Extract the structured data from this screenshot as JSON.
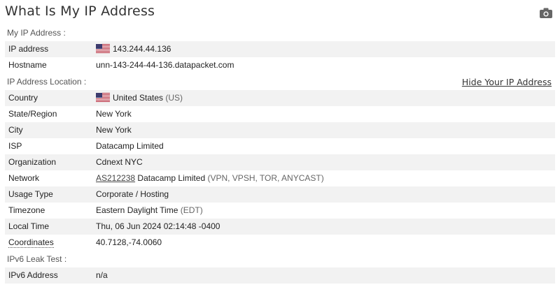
{
  "title": "What Is My IP Address",
  "icons": {
    "camera": "camera-icon",
    "flag": "us-flag-icon"
  },
  "sections": {
    "my_ip": {
      "heading": "My IP Address :",
      "ip_address": {
        "label": "IP address",
        "value": "143.244.44.136"
      },
      "hostname": {
        "label": "Hostname",
        "value": "unn-143-244-44-136.datapacket.com"
      }
    },
    "location": {
      "heading": "IP Address Location :",
      "hide_link": "Hide Your IP Address",
      "country": {
        "label": "Country",
        "value": "United States",
        "code": "(US)"
      },
      "state": {
        "label": "State/Region",
        "value": "New York"
      },
      "city": {
        "label": "City",
        "value": "New York"
      },
      "isp": {
        "label": "ISP",
        "value": "Datacamp Limited"
      },
      "organization": {
        "label": "Organization",
        "value": "Cdnext NYC"
      },
      "network": {
        "label": "Network",
        "asn": "AS212238",
        "value": "Datacamp Limited",
        "tags": "(VPN, VPSH, TOR, ANYCAST)"
      },
      "usage_type": {
        "label": "Usage Type",
        "value": "Corporate / Hosting"
      },
      "timezone": {
        "label": "Timezone",
        "value": "Eastern Daylight Time",
        "abbr": "(EDT)"
      },
      "local_time": {
        "label": "Local Time",
        "value": "Thu, 06 Jun 2024 02:14:48 -0400"
      },
      "coordinates": {
        "label": "Coordinates",
        "value": "40.7128,-74.0060"
      }
    },
    "ipv6": {
      "heading": "IPv6 Leak Test :",
      "address": {
        "label": "IPv6 Address",
        "value": "n/a"
      }
    }
  }
}
